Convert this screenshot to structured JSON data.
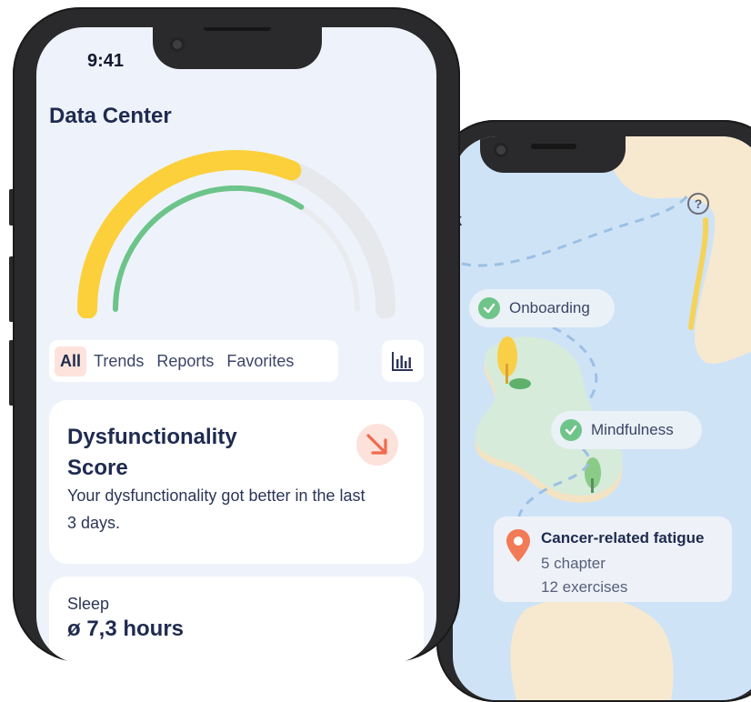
{
  "front": {
    "status_time": "9:41",
    "title": "Data Center",
    "gauge": {
      "outer_level": 0.62,
      "inner_level": 0.68,
      "outer_color": "#fcd03a",
      "inner_color": "#6cc48a",
      "track_color": "#e6e8ec"
    },
    "tabs": [
      {
        "label": "All",
        "active": true
      },
      {
        "label": "Trends"
      },
      {
        "label": "Reports"
      },
      {
        "label": "Favorites"
      }
    ],
    "chart_button_icon": "bar-chart-icon",
    "dysfunctionality_card": {
      "title": "Dysfunctionality Score",
      "description": "Your dysfunctionality got better in the last 3 days.",
      "trend_icon": "arrow-down-right-icon",
      "trend_color": "#f06a4d"
    },
    "sleep_card": {
      "label": "Sleep",
      "value": "ø 7,3 hours"
    }
  },
  "back": {
    "partial_header": "k",
    "help_icon": "question-circle-icon",
    "milestones": [
      {
        "label": "Onboarding",
        "completed": true
      },
      {
        "label": "Mindfulness",
        "completed": true
      }
    ],
    "course": {
      "title": "Cancer-related fatigue",
      "chapters": "5 chapter",
      "exercises": "12 exercises",
      "pin_icon": "location-pin-icon",
      "pin_color": "#f27a56"
    }
  }
}
